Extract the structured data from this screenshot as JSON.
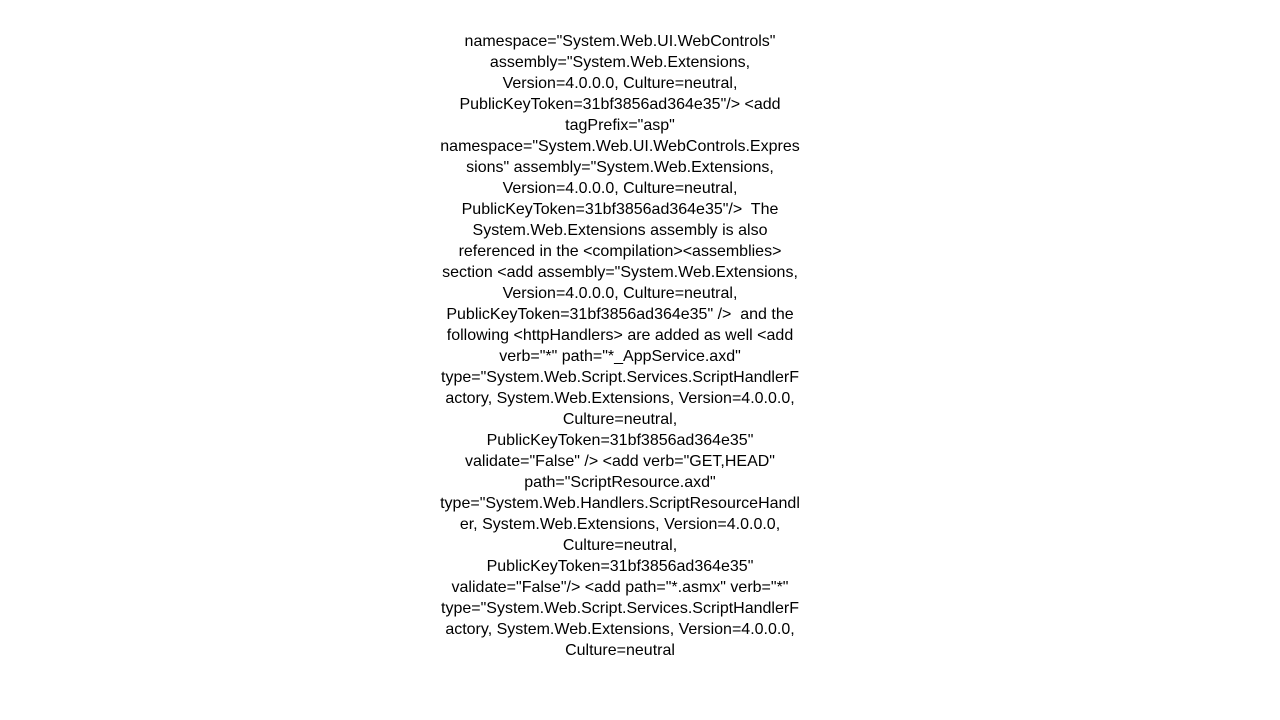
{
  "document": {
    "kind": "plain-text",
    "background_color": "#ffffff",
    "text_color": "#000000",
    "alignment": "center",
    "scrolled": true,
    "first_line_clipped": true,
    "body_text": "namespace=\"System.Web.UI.WebControls\" assembly=\"System.Web.Extensions, Version=4.0.0.0, Culture=neutral, PublicKeyToken=31bf3856ad364e35\"/> <add tagPrefix=\"asp\" namespace=\"System.Web.UI.WebControls.Expressions\" assembly=\"System.Web.Extensions, Version=4.0.0.0, Culture=neutral, PublicKeyToken=31bf3856ad364e35\"/>  The System.Web.Extensions assembly is also referenced in the <compilation><assemblies> section <add assembly=\"System.Web.Extensions, Version=4.0.0.0, Culture=neutral, PublicKeyToken=31bf3856ad364e35\" />  and the following <httpHandlers> are added as well <add verb=\"*\" path=\"*_AppService.axd\" type=\"System.Web.Script.Services.ScriptHandlerFactory, System.Web.Extensions, Version=4.0.0.0, Culture=neutral, PublicKeyToken=31bf3856ad364e35\" validate=\"False\" /> <add verb=\"GET,HEAD\" path=\"ScriptResource.axd\" type=\"System.Web.Handlers.ScriptResourceHandler, System.Web.Extensions, Version=4.0.0.0, Culture=neutral, PublicKeyToken=31bf3856ad364e35\" validate=\"False\"/> <add path=\"*.asmx\" verb=\"*\" type=\"System.Web.Script.Services.ScriptHandlerFactory, System.Web.Extensions, Version=4.0.0.0, Culture=neutral"
  }
}
